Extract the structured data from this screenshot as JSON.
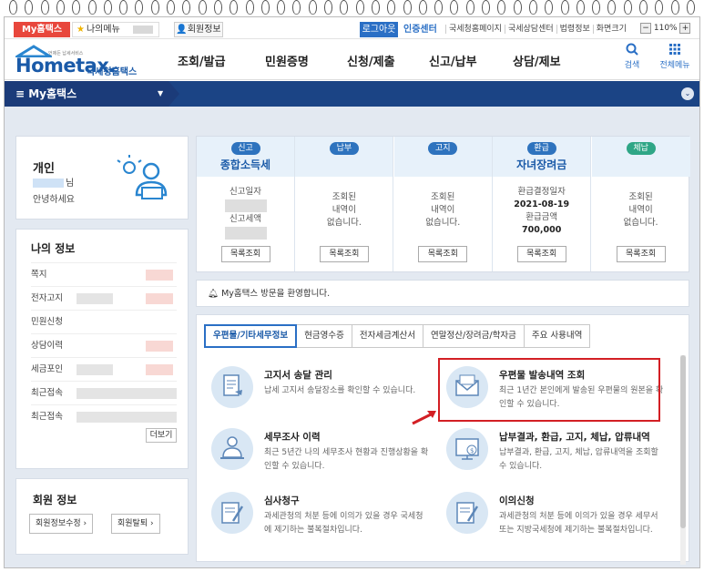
{
  "util": {
    "myhometax": "My홈택스",
    "mymenu": "나의메뉴",
    "member_info": "회원정보",
    "logout": "로그아웃",
    "cert_center": "인증센터",
    "links": [
      "국세청홈페이지",
      "국세상담센터",
      "법령정보",
      "화면크기"
    ],
    "zoom": "110%"
  },
  "header": {
    "logo_brand": "Hometax.",
    "logo_kr": "국세청홈택스",
    "logo_tagline": "언제든 납세서비스",
    "nav": [
      "조회/발급",
      "민원증명",
      "신청/제출",
      "신고/납부",
      "상담/제보"
    ],
    "search": "검색",
    "all_menu": "전체메뉴"
  },
  "bluebar": {
    "title": "My홈택스"
  },
  "greeting": {
    "title": "개인",
    "name_suffix": "님",
    "hello": "안녕하세요"
  },
  "myinfo": {
    "title": "나의 정보",
    "rows": [
      "쪽지",
      "전자고지",
      "민원신청",
      "상담이력",
      "세금포인",
      "최근접속",
      "최근접속"
    ],
    "more": "더보기"
  },
  "member": {
    "title": "회원 정보",
    "edit": "회원정보수정",
    "withdraw": "회원탈퇴"
  },
  "status": [
    {
      "badge": "신고",
      "title": "종합소득세",
      "lines": [
        "신고일자",
        "신고세액"
      ],
      "btn": "목록조회"
    },
    {
      "badge": "납부",
      "title": "",
      "lines": [
        "조회된",
        "내역이",
        "없습니다."
      ],
      "btn": "목록조회"
    },
    {
      "badge": "고지",
      "title": "",
      "lines": [
        "조회된",
        "내역이",
        "없습니다."
      ],
      "btn": "목록조회"
    },
    {
      "badge": "환급",
      "title": "자녀장려금",
      "lines": [
        "환급결정일자",
        "2021-08-19",
        "환급금액",
        "700,000"
      ],
      "btn": "목록조회"
    },
    {
      "badge": "체납",
      "title": "",
      "lines": [
        "조회된",
        "내역이",
        "없습니다."
      ],
      "btn": "목록조회"
    }
  ],
  "welcome": "My홈택스 방문을 환영합니다.",
  "tabs": [
    "우편물/기타세무정보",
    "현금영수증",
    "전자세금계산서",
    "연말정산/장려금/학자금",
    "주요 사용내역"
  ],
  "services": [
    {
      "title": "고지서 송달 관리",
      "desc": "납세 고지서 송달장소를 확인할 수 있습니다."
    },
    {
      "title": "우편물 발송내역 조회",
      "desc": "최근 1년간 본인에게 발송된 우편물의 원본을 확인할 수 있습니다."
    },
    {
      "title": "세무조사 이력",
      "desc": "최근 5년간 나의 세무조사 현황과 진행상황을 확인할 수 있습니다."
    },
    {
      "title": "납부결과, 환급, 고지, 체납, 압류내역",
      "desc": "납부결과, 환급, 고지, 체납, 압류내역을 조회할 수 있습니다."
    },
    {
      "title": "심사청구",
      "desc": "과세관청의 처분 등에 이의가 있을 경우 국세청에 제기하는 불복절차입니다."
    },
    {
      "title": "이의신청",
      "desc": "과세관청의 처분 등에 이의가 있을 경우 세무서 또는 지방국세청에 제기하는 불복절차입니다."
    }
  ],
  "colors": {
    "brand_blue": "#1a5aa8",
    "nav_bar": "#1b3b79",
    "highlight_red": "#d31f24",
    "my_tag": "#e8473c"
  }
}
